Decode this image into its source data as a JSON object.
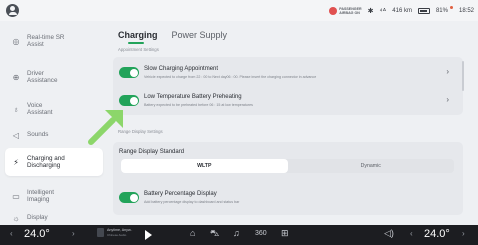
{
  "status_bar": {
    "airbag_text": "PASSENGER\nAIRBAG ON",
    "range": "416 km",
    "battery": "81%",
    "time": "18:52"
  },
  "sidebar": {
    "items": [
      {
        "label": "Real-time SR\nAssist",
        "icon": "sr-assist-icon"
      },
      {
        "label": "Driver\nAssistance",
        "icon": "steering-icon"
      },
      {
        "label": "Voice\nAssistant",
        "icon": "voice-icon"
      },
      {
        "label": "Sounds",
        "icon": "speaker-icon"
      },
      {
        "label": "Charging and\nDischarging",
        "icon": "plug-icon"
      },
      {
        "label": "Intelligent\nImaging",
        "icon": "camera-icon"
      },
      {
        "label": "Display",
        "icon": "brightness-icon"
      }
    ]
  },
  "main": {
    "tabs": [
      {
        "label": "Charging"
      },
      {
        "label": "Power Supply"
      }
    ],
    "appointment_section_title": "Appointment Settings",
    "slow_charging": {
      "title": "Slow Charging Appointment",
      "subtitle": "Vehicle expected to charge from 22 : 00 to Next day06 : 00. Please insert the charging connector in advance",
      "enabled": true
    },
    "low_temp": {
      "title": "Low Temperature Battery Preheating",
      "subtitle": "Battery expected to be preheated before 06 : 15 at low temperatures",
      "enabled": true
    },
    "range_section_title": "Range Display Settings",
    "range_standard": {
      "label": "Range Display Standard",
      "options": [
        "WLTP",
        "Dynamic"
      ],
      "selected": "WLTP"
    },
    "battery_percentage": {
      "title": "Battery Percentage Display",
      "subtitle": "Add battery percentage display to dashboard and status bar",
      "enabled": true
    }
  },
  "dock": {
    "temp_left": "24.0°",
    "temp_right": "24.0°",
    "media_title": "Anytime, Anyw..",
    "media_sub": "Chinese Audio",
    "cam_label": "360"
  },
  "colors": {
    "accent": "#22a35a",
    "arrow": "#8cd66a",
    "dock_bg": "#1c1d21"
  }
}
